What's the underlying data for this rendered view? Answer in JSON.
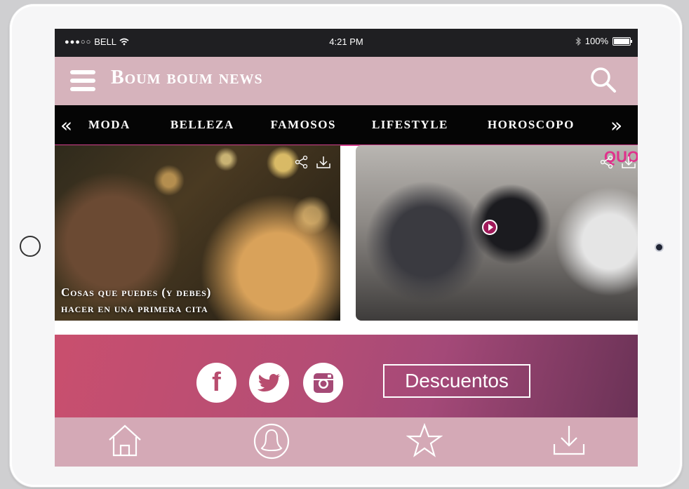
{
  "status_bar": {
    "signal": "●●●○○",
    "carrier": "BELL",
    "time": "4:21 PM",
    "battery": "100%"
  },
  "header": {
    "brand": "Boum boum news",
    "menu_icon": "hamburger-icon",
    "search_icon": "search-icon",
    "background": "#d6b3bc"
  },
  "categories": {
    "prev_arrow": "«",
    "next_arrow": "»",
    "items": [
      "MODA",
      "BELLEZA",
      "FAMOSOS",
      "LIFESTYLE",
      "HOROSCOPO"
    ],
    "accent": "#d33f8d"
  },
  "articles": [
    {
      "caption_line1": "Cosas que puedes (y debes)",
      "caption_line2": "hacer en una primera cita",
      "share_icon": "share-icon",
      "download_icon": "download-icon"
    },
    {
      "badge": "QUO",
      "play_icon": "play-icon",
      "share_icon": "share-icon",
      "download_icon": "download-icon"
    }
  ],
  "social": {
    "facebook": "f",
    "twitter_icon": "twitter-icon",
    "instagram_icon": "instagram-icon",
    "discount_label": "Descuentos"
  },
  "tabbar": {
    "icons": [
      "home-icon",
      "profile-icon",
      "star-icon",
      "download-icon"
    ]
  }
}
